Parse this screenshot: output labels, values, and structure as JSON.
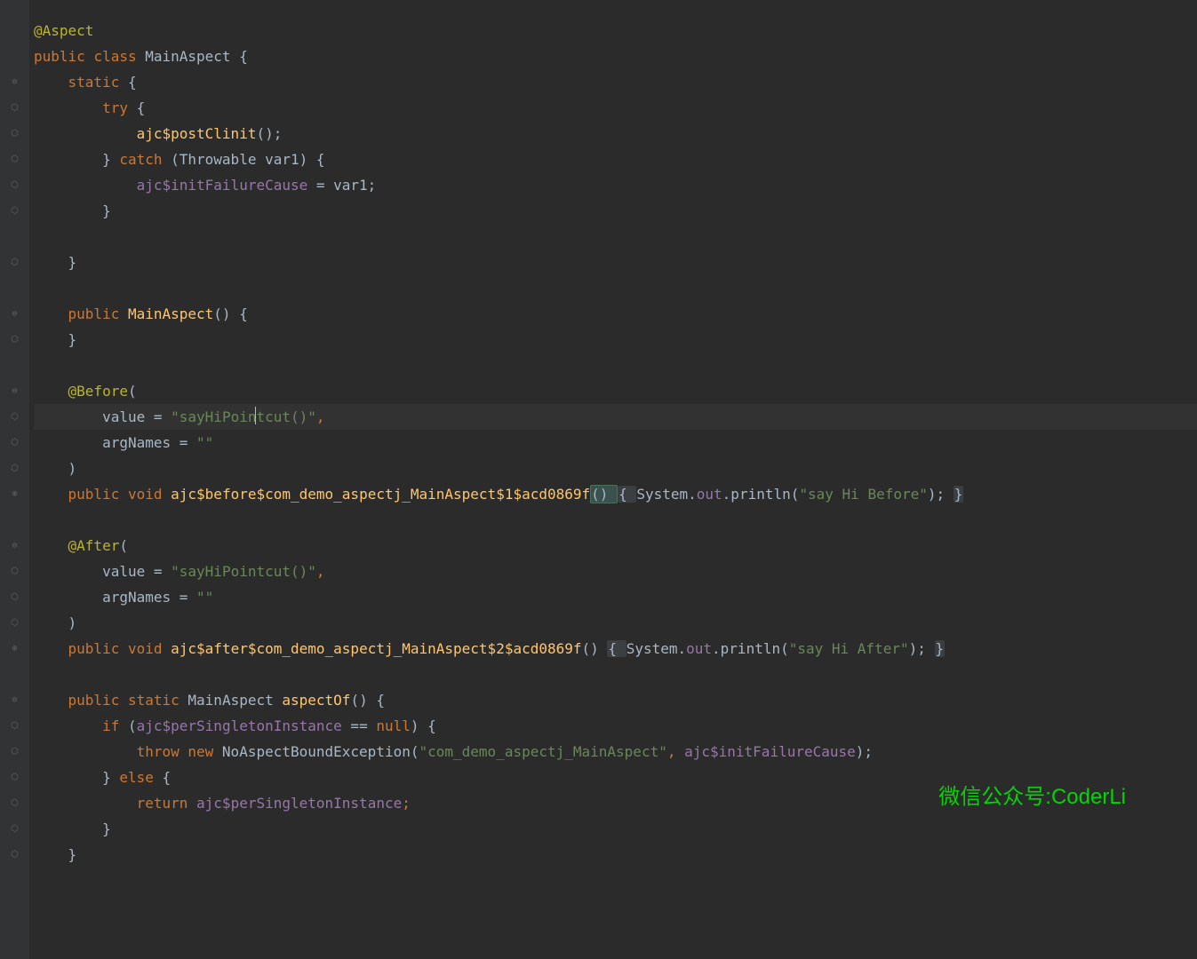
{
  "code": {
    "l1": "@Aspect",
    "l2_public": "public ",
    "l2_class": "class ",
    "l2_name": "MainAspect {",
    "l3_static": "    static ",
    "l3_brace": "{",
    "l4_try": "        try ",
    "l4_brace": "{",
    "l5_indent": "            ",
    "l5_method": "ajc$postClinit",
    "l5_paren": "();",
    "l6_indent": "        } ",
    "l6_catch": "catch ",
    "l6_paren": "(Throwable var1) {",
    "l7_indent": "            ",
    "l7_field": "ajc$initFailureCause",
    "l7_rest": " = var1;",
    "l8": "        }",
    "l10": "    }",
    "l12_public": "    public ",
    "l12_method": "MainAspect",
    "l12_rest": "() {",
    "l13": "    }",
    "l15_anno": "    @Before",
    "l15_paren": "(",
    "l16_indent": "        ",
    "l16_value": "value",
    "l16_eq": " = ",
    "l16_str1": "\"sayHiPoin",
    "l16_str2": "tcut()\"",
    "l16_comma": ",",
    "l17_indent": "        ",
    "l17_argnames": "argNames",
    "l17_eq": " = ",
    "l17_str": "\"\"",
    "l18": "    )",
    "l19_public": "    public ",
    "l19_void": "void ",
    "l19_method": "ajc$before$com_demo_aspectj_MainAspect$1$acd0869f",
    "l19_paren": "() ",
    "l19_brace_o": "{ ",
    "l19_sys": "System.",
    "l19_out": "out",
    "l19_print": ".println(",
    "l19_str": "\"say Hi Before\"",
    "l19_end": "); ",
    "l19_brace_c": "}",
    "l21_anno": "    @After",
    "l21_paren": "(",
    "l22_indent": "        ",
    "l22_value": "value",
    "l22_eq": " = ",
    "l22_str": "\"sayHiPointcut()\"",
    "l22_comma": ",",
    "l23_indent": "        ",
    "l23_argnames": "argNames",
    "l23_eq": " = ",
    "l23_str": "\"\"",
    "l24": "    )",
    "l25_public": "    public ",
    "l25_void": "void ",
    "l25_method": "ajc$after$com_demo_aspectj_MainAspect$2$acd0869f",
    "l25_paren": "() ",
    "l25_brace_o": "{ ",
    "l25_sys": "System.",
    "l25_out": "out",
    "l25_print": ".println(",
    "l25_str": "\"say Hi After\"",
    "l25_end": "); ",
    "l25_brace_c": "}",
    "l27_public": "    public ",
    "l27_static": "static ",
    "l27_rest": "MainAspect ",
    "l27_method": "aspectOf",
    "l27_end": "() {",
    "l28_if": "        if ",
    "l28_paren": "(",
    "l28_field": "ajc$perSingletonInstance",
    "l28_eq": " == ",
    "l28_null": "null",
    "l28_end": ") {",
    "l29_throw": "            throw ",
    "l29_new": "new ",
    "l29_ex": "NoAspectBoundException(",
    "l29_str": "\"com_demo_aspectj_MainAspect\"",
    "l29_c": ", ",
    "l29_field": "ajc$initFailureCause",
    "l29_end": ");",
    "l30_indent": "        } ",
    "l30_else": "else ",
    "l30_brace": "{",
    "l31_return": "            return ",
    "l31_field": "ajc$perSingletonInstance",
    "l31_end": ";",
    "l32": "        }",
    "l33": "    }"
  },
  "watermark": "微信公众号:CoderLi",
  "icons": {
    "fold_minus": "⊖",
    "fold_plus": "⊕",
    "pin": "⬡"
  }
}
